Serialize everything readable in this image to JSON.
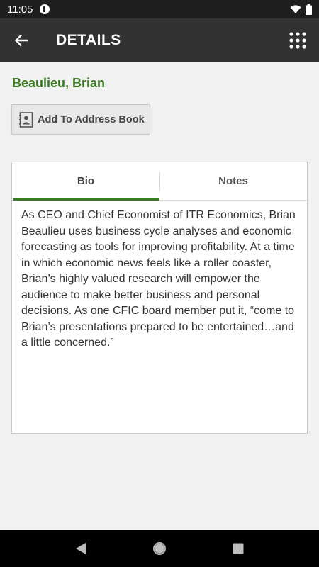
{
  "status_bar": {
    "time": "11:05"
  },
  "app_bar": {
    "title": "DETAILS"
  },
  "person": {
    "name": "Beaulieu, Brian"
  },
  "actions": {
    "add_to_address_book": "Add To Address Book"
  },
  "tabs": [
    {
      "label": "Bio",
      "active": true
    },
    {
      "label": "Notes",
      "active": false
    }
  ],
  "bio": {
    "text": "As CEO and Chief Economist of ITR Economics, Brian Beaulieu uses business cycle analyses and economic forecasting as tools for improving profitability. At a time in which economic news feels like a roller coaster, Brian’s highly valued research will empower the audience to make better business and personal decisions. As one CFIC board member put it, “come to Brian’s presentations prepared to be entertained…and a little concerned.”"
  },
  "colors": {
    "accent": "#3a7a22",
    "app_bar": "#323232",
    "background": "#f1f1f1"
  },
  "icons": [
    "back-arrow-icon",
    "grid-menu-icon",
    "contact-card-icon",
    "wifi-icon",
    "battery-icon",
    "nav-back-icon",
    "nav-home-icon",
    "nav-recents-icon"
  ]
}
